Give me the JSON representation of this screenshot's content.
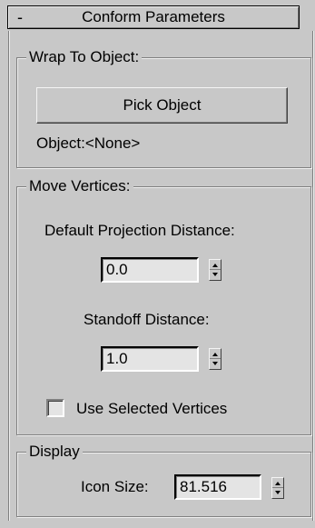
{
  "rollout": {
    "toggle": "-",
    "title": "Conform Parameters"
  },
  "wrap_group": {
    "legend": "Wrap To Object:",
    "pick_button": "Pick Object",
    "object_label": "Object:<None>"
  },
  "move_group": {
    "legend": "Move Vertices:",
    "projection_label": "Default Projection Distance:",
    "projection_value": "0.0",
    "standoff_label": "Standoff Distance:",
    "standoff_value": "1.0",
    "use_selected_label": "Use Selected Vertices",
    "use_selected_checked": false
  },
  "display_group": {
    "legend": "Display",
    "icon_size_label": "Icon Size:",
    "icon_size_value": "81.516"
  },
  "icons": {
    "spinner": "spinner-arrows-icon"
  }
}
